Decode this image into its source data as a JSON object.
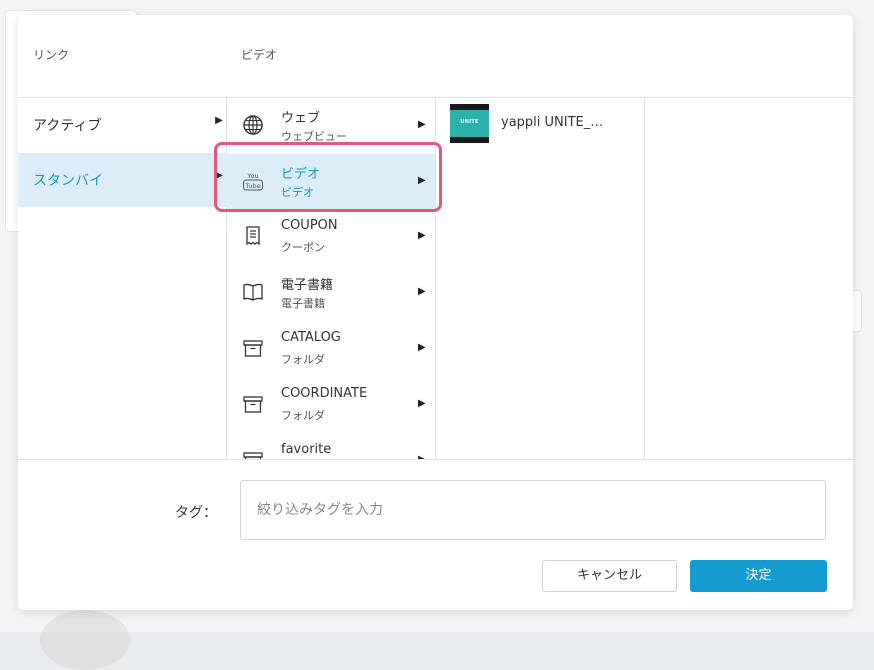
{
  "header": {
    "link_label": "リンク",
    "video_label": "ビデオ"
  },
  "column1": {
    "items": [
      {
        "label": "アクティブ",
        "selected": false
      },
      {
        "label": "スタンバイ",
        "selected": true
      }
    ]
  },
  "column2": {
    "items": [
      {
        "title": "ウェブ",
        "sub": "ウェブビュー",
        "icon": "globe-icon"
      },
      {
        "title": "ビデオ",
        "sub": "ビデオ",
        "icon": "youtube-icon",
        "selected": true
      },
      {
        "title": "COUPON",
        "sub": "クーポン",
        "icon": "receipt-icon"
      },
      {
        "title": "電子書籍",
        "sub": "電子書籍",
        "icon": "book-icon"
      },
      {
        "title": "CATALOG",
        "sub": "フォルダ",
        "icon": "archive-box-icon"
      },
      {
        "title": "COORDINATE",
        "sub": "フォルダ",
        "icon": "archive-box-icon"
      },
      {
        "title": "favorite",
        "sub": "",
        "icon": "archive-box-icon"
      }
    ]
  },
  "column3": {
    "items": [
      {
        "title": "yappli UNITE_…",
        "thumb_text": "UNITE"
      }
    ]
  },
  "footer": {
    "tag_label": "タグ：",
    "tag_placeholder": "絞り込みタグを入力",
    "cancel_label": "キャンセル",
    "ok_label": "決定"
  },
  "colors": {
    "accent": "#159bd0",
    "selected_bg": "#dcedf7",
    "highlight": "#e4577a"
  }
}
